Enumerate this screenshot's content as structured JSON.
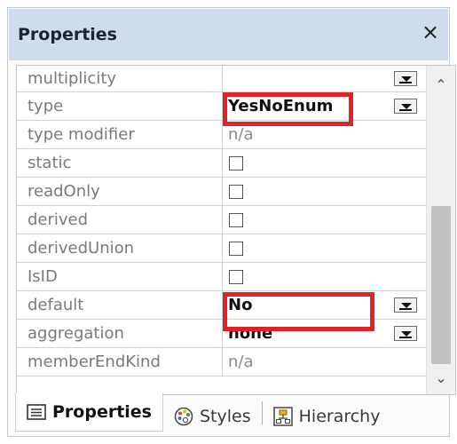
{
  "panel": {
    "title": "Properties",
    "close_label": "×"
  },
  "properties": [
    {
      "name": "multiplicity",
      "value": "",
      "kind": "dropdown"
    },
    {
      "name": "type",
      "value": "YesNoEnum",
      "kind": "dropdown",
      "emphasis": true,
      "highlighted": true
    },
    {
      "name": "type modifier",
      "value": "n/a",
      "kind": "text-dim"
    },
    {
      "name": "static",
      "kind": "checkbox",
      "checked": false
    },
    {
      "name": "readOnly",
      "kind": "checkbox",
      "checked": false
    },
    {
      "name": "derived",
      "kind": "checkbox",
      "checked": false
    },
    {
      "name": "derivedUnion",
      "kind": "checkbox",
      "checked": false
    },
    {
      "name": "IsID",
      "kind": "checkbox",
      "checked": false
    },
    {
      "name": "default",
      "value": "No",
      "kind": "dropdown",
      "emphasis": true,
      "highlighted": true
    },
    {
      "name": "aggregation",
      "value": "none",
      "kind": "dropdown",
      "emphasis": true
    },
    {
      "name": "memberEndKind",
      "value": "n/a",
      "kind": "text-dim"
    }
  ],
  "scrollbar": {
    "up_label": "⌃",
    "down_label": "⌄"
  },
  "tabs": [
    {
      "label": "Properties",
      "icon": "properties-icon",
      "active": true
    },
    {
      "label": "Styles",
      "icon": "palette-icon",
      "active": false
    },
    {
      "label": "Hierarchy",
      "icon": "hierarchy-icon",
      "active": false
    }
  ],
  "colors": {
    "title_bar": "#cfdcec",
    "highlight": "#e02225"
  }
}
